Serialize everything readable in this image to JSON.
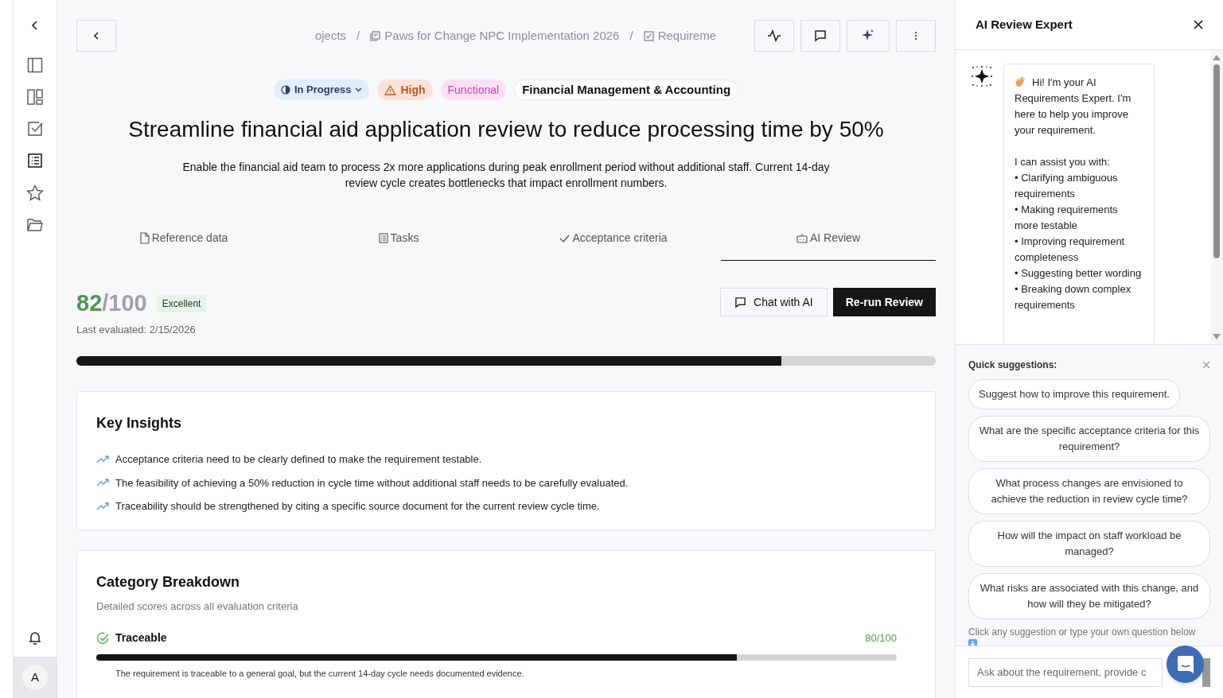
{
  "breadcrumb": [
    {
      "kind": "plain",
      "text": "ojects"
    },
    {
      "kind": "separator",
      "text": "/"
    },
    {
      "kind": "project",
      "text": "Paws for Change NPC Implementation 2026"
    },
    {
      "kind": "separator",
      "text": "/"
    },
    {
      "kind": "requirement",
      "text": "Requireme"
    }
  ],
  "badges": [
    {
      "kind": "status",
      "label": "In Progress"
    },
    {
      "kind": "priority",
      "label": "High"
    },
    {
      "kind": "type",
      "label": "Functional"
    },
    {
      "kind": "category",
      "label": "Financial Management & Accounting"
    }
  ],
  "title": "Streamline financial aid application review to reduce processing time by 50%",
  "description": "Enable the financial aid team to process 2x more applications during peak enrollment period without additional staff. Current 14-day review cycle creates bottlenecks that impact enrollment numbers.",
  "tabs": [
    {
      "label": "Reference data",
      "selected": false
    },
    {
      "label": "Tasks",
      "selected": false
    },
    {
      "label": "Acceptance criteria",
      "selected": false
    },
    {
      "label": "AI Review",
      "selected": true
    }
  ],
  "score": {
    "value": "82",
    "max": "/100",
    "rating": "Excellent",
    "evaluated": "Last evaluated: 2/15/2026",
    "level": 0.82
  },
  "actions": [
    "Chat with AI",
    "Re-run Review"
  ],
  "insights": {
    "title": "Key Insights",
    "items": [
      "Acceptance criteria need to be clearly defined to make the requirement testable.",
      "The feasibility of achieving a 50% reduction in cycle time without additional staff needs to be carefully evaluated.",
      "Traceability should be strengthened by citing a specific source document for the current review cycle time."
    ]
  },
  "breakdown": {
    "title": "Category Breakdown",
    "subtitle": "Detailed scores across all evaluation criteria",
    "categories": [
      {
        "name": "Traceable",
        "score": "80/100",
        "level": 0.8,
        "note": "The requirement is traceable to a general goal, but the current 14-day cycle needs documented evidence."
      }
    ]
  },
  "user_avatar": "A",
  "panel": {
    "title": "AI Review Expert",
    "message": {
      "intro": "Hi! I'm your AI Requirements Expert. I'm here to help you improve your requirement.",
      "heading": "I can assist you with:",
      "bullets": [
        "• Clarifying ambiguous requirements",
        "• Making requirements more testable",
        "• Improving requirement completeness",
        "• Suggesting better wording",
        "• Breaking down complex requirements"
      ]
    },
    "suggestions_title": "Quick suggestions:",
    "suggestions": [
      "Suggest how to improve this requirement.",
      "What are the specific acceptance criteria for this requirement?",
      "What process changes are envisioned to achieve the reduction in review cycle time?",
      "How will the impact on staff workload be managed?",
      "What risks are associated with this change, and how will they be mitigated?"
    ],
    "hint": "Click any suggestion or type your own question below",
    "input_placeholder": "Ask about the requirement, provide c"
  }
}
